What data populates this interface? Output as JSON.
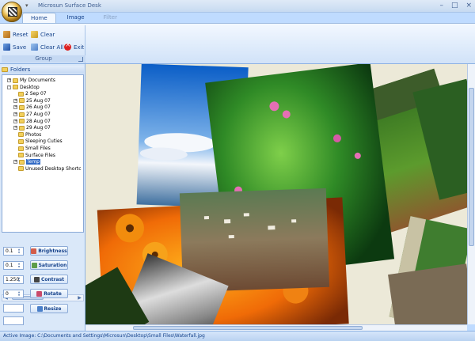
{
  "window": {
    "title": "Microsun Surface Desk",
    "qat_arrow": "▾",
    "controls": [
      "–",
      "□",
      "×"
    ]
  },
  "tabs": [
    {
      "label": "Home",
      "active": true
    },
    {
      "label": "Image",
      "active": false
    },
    {
      "label": "Filter",
      "active": false
    }
  ],
  "ribbon": {
    "group_label": "Group",
    "buttons": {
      "reset": "Reset",
      "clear": "Clear",
      "save": "Save",
      "clear_all": "Clear All",
      "exit": "Exit"
    }
  },
  "folders": {
    "header": "Folders",
    "tree": [
      {
        "label": "My Documents",
        "expander": "+"
      },
      {
        "label": "Desktop",
        "expander": "-"
      },
      {
        "label": "2 Sep 07",
        "expander": ""
      },
      {
        "label": "25 Aug 07",
        "expander": "+"
      },
      {
        "label": "26 Aug 07",
        "expander": "+"
      },
      {
        "label": "27 Aug 07",
        "expander": "+"
      },
      {
        "label": "28 Aug 07",
        "expander": "+"
      },
      {
        "label": "29 Aug 07",
        "expander": "+"
      },
      {
        "label": "Photos",
        "expander": ""
      },
      {
        "label": "Sleeping Cuties",
        "expander": ""
      },
      {
        "label": "Small Files",
        "expander": ""
      },
      {
        "label": "Surface Files",
        "expander": ""
      },
      {
        "label": "Temp",
        "expander": "+",
        "selected": true
      },
      {
        "label": "Unused Desktop Shortc",
        "expander": ""
      }
    ]
  },
  "controls": {
    "brightness_value": "0.1",
    "saturation_value": "0.1",
    "contrast_value": "1.250",
    "rotate_value": "0",
    "brightness_label": "Brightness",
    "saturation_label": "Saturation",
    "contrast_label": "Contrast",
    "rotate_label": "Rotate",
    "resize_label": "Resize"
  },
  "status": {
    "text": "Active Image: C:\\Documents and Settings\\Microsun\\Desktop\\Small Files\\Waterfall.jpg"
  },
  "photo_scenes": [
    "sky-sea",
    "pink-flowers",
    "green-hills",
    "village",
    "orange-flowers",
    "waterfall",
    "leaves"
  ]
}
